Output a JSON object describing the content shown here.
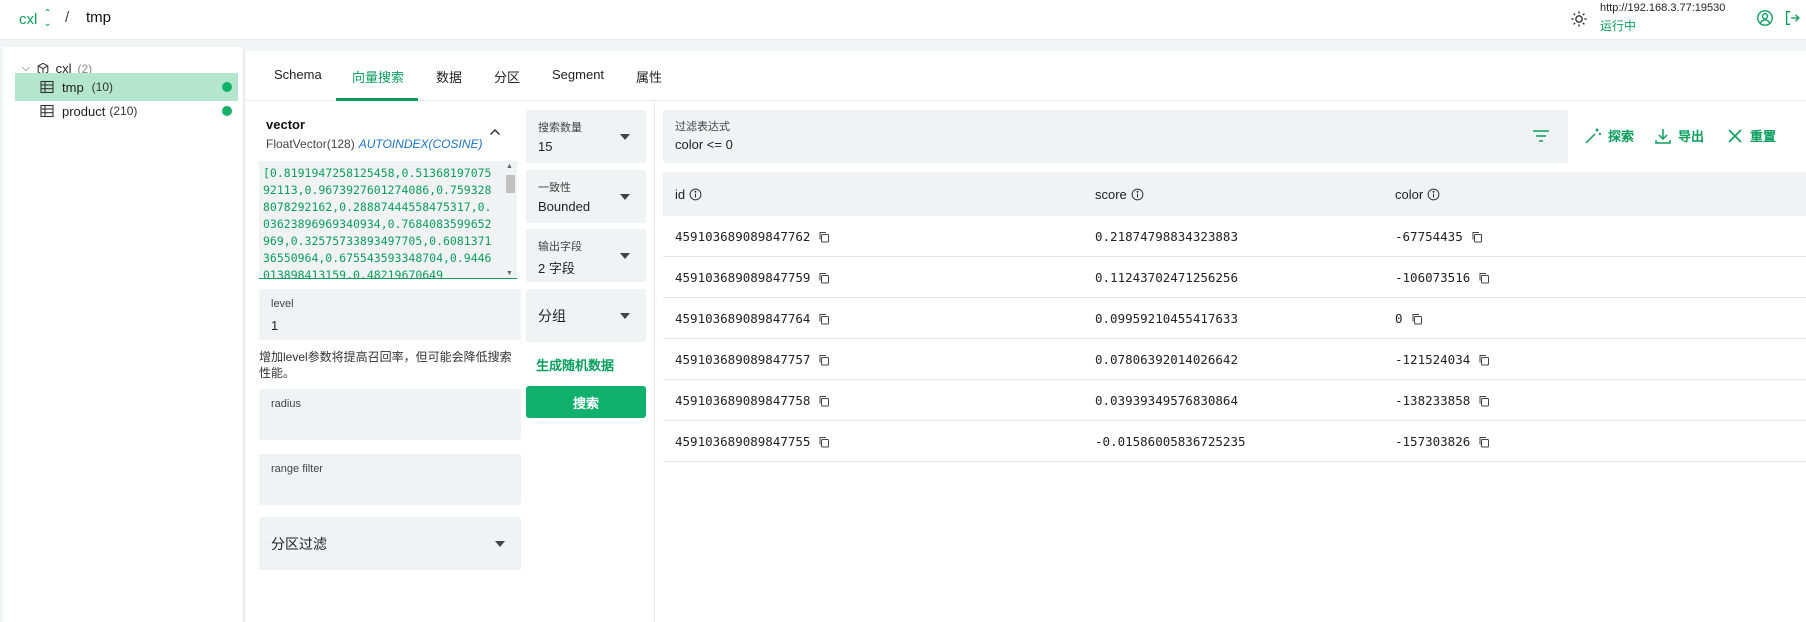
{
  "breadcrumb": {
    "database": "cxl",
    "separator": "/",
    "collection": "tmp"
  },
  "connection": {
    "address": "http://192.168.3.77:19530",
    "status": "运行中"
  },
  "sidebar": {
    "database": {
      "name": "cxl",
      "count": "(2)"
    },
    "collections": [
      {
        "name": "tmp",
        "count": "(10)",
        "loaded": true,
        "active": true
      },
      {
        "name": "product",
        "count": "(210)",
        "loaded": true,
        "active": false
      }
    ]
  },
  "tabs": [
    {
      "label": "Schema",
      "active": false
    },
    {
      "label": "向量搜索",
      "active": true
    },
    {
      "label": "数据",
      "active": false
    },
    {
      "label": "分区",
      "active": false
    },
    {
      "label": "Segment",
      "active": false
    },
    {
      "label": "属性",
      "active": false
    }
  ],
  "vector": {
    "field_name": "vector",
    "type": "FloatVector(128)",
    "index": "AUTOINDEX(COSINE)",
    "value": "[0.8191947258125458,0.5136819707592113,0.9673927601274086,0.7593288078292162,0.28887444558475317,0.03623896969340934,0.7684083599652969,0.32575733893497705,0.608137136550964,0.675543593348704,0.9446013898413159,0.48219670649"
  },
  "params": {
    "level": {
      "label": "level",
      "value": "1"
    },
    "level_hint": "增加level参数将提高召回率，但可能会降低搜索性能。",
    "radius": {
      "label": "radius",
      "value": ""
    },
    "range_filter": {
      "label": "range filter",
      "value": ""
    },
    "partition_filter": {
      "label": "分区过滤"
    }
  },
  "search_options": {
    "topk": {
      "label": "搜索数量",
      "value": "15"
    },
    "consistency": {
      "label": "一致性",
      "value": "Bounded"
    },
    "output_fields": {
      "label": "输出字段",
      "value": "2 字段"
    },
    "group_by": {
      "label": "分组"
    },
    "generate_random_label": "生成随机数据",
    "search_label": "搜索"
  },
  "filter": {
    "label": "过滤表达式",
    "value": "color <= 0"
  },
  "actions": {
    "explore": "探索",
    "export": "导出",
    "reset": "重置"
  },
  "results": {
    "columns": [
      "id",
      "score",
      "color"
    ],
    "rows": [
      {
        "id": "459103689089847762",
        "score": "0.21874798834323883",
        "color": "-67754435"
      },
      {
        "id": "459103689089847759",
        "score": "0.11243702471256256",
        "color": "-106073516"
      },
      {
        "id": "459103689089847764",
        "score": "0.09959210455417633",
        "color": "0"
      },
      {
        "id": "459103689089847757",
        "score": "0.07806392014026642",
        "color": "-121524034"
      },
      {
        "id": "459103689089847758",
        "score": "0.03939349576830864",
        "color": "-138233858"
      },
      {
        "id": "459103689089847755",
        "score": "-0.01586005836725235",
        "color": "-157303826"
      }
    ]
  },
  "colors": {
    "accent": "#0a9e5e",
    "active_row": "#b4e6ce",
    "button": "#0fb16c",
    "index_link": "#1a73c8"
  }
}
